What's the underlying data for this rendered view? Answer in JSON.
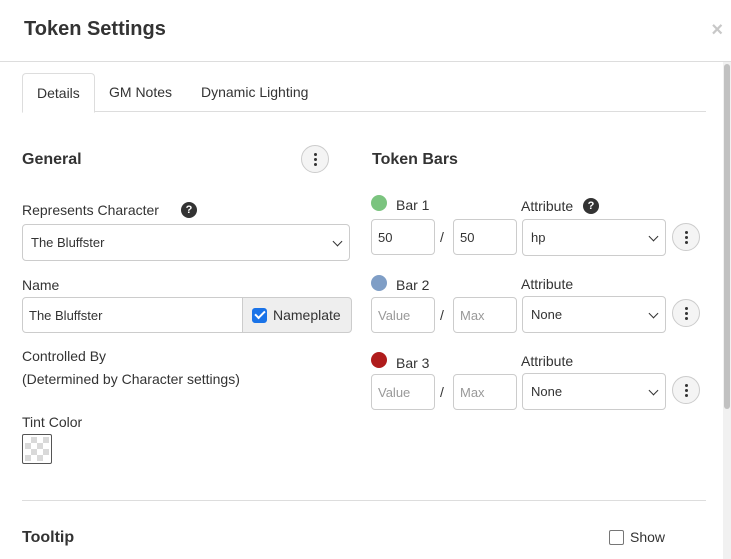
{
  "dialog": {
    "title": "Token Settings",
    "close_glyph": "×"
  },
  "tabs": [
    {
      "label": "Details",
      "active": true
    },
    {
      "label": "GM Notes",
      "active": false
    },
    {
      "label": "Dynamic Lighting",
      "active": false
    }
  ],
  "general": {
    "title": "General",
    "represents_label": "Represents Character",
    "represents_value": "The Bluffster",
    "name_label": "Name",
    "name_value": "The Bluffster",
    "nameplate_label": "Nameplate",
    "nameplate_checked": true,
    "controlled_by_label": "Controlled By",
    "controlled_by_value": "(Determined by Character settings)",
    "tint_label": "Tint Color"
  },
  "token_bars": {
    "title": "Token Bars",
    "value_placeholder": "Value",
    "max_placeholder": "Max",
    "slash": "/",
    "bars": [
      {
        "label": "Bar 1",
        "color": "#7bc47f",
        "value": "50",
        "max": "50",
        "attribute_label": "Attribute",
        "attribute": "hp",
        "has_help": true
      },
      {
        "label": "Bar 2",
        "color": "#7f9ec6",
        "value": "",
        "max": "",
        "attribute_label": "Attribute",
        "attribute": "None",
        "has_help": false
      },
      {
        "label": "Bar 3",
        "color": "#b01c1c",
        "value": "",
        "max": "",
        "attribute_label": "Attribute",
        "attribute": "None",
        "has_help": false
      }
    ]
  },
  "tooltip": {
    "title": "Tooltip",
    "show_label": "Show",
    "show_checked": false
  },
  "icons": {
    "help": "?"
  },
  "colors": {
    "accent": "#1a73e8",
    "border": "#cccccc"
  }
}
